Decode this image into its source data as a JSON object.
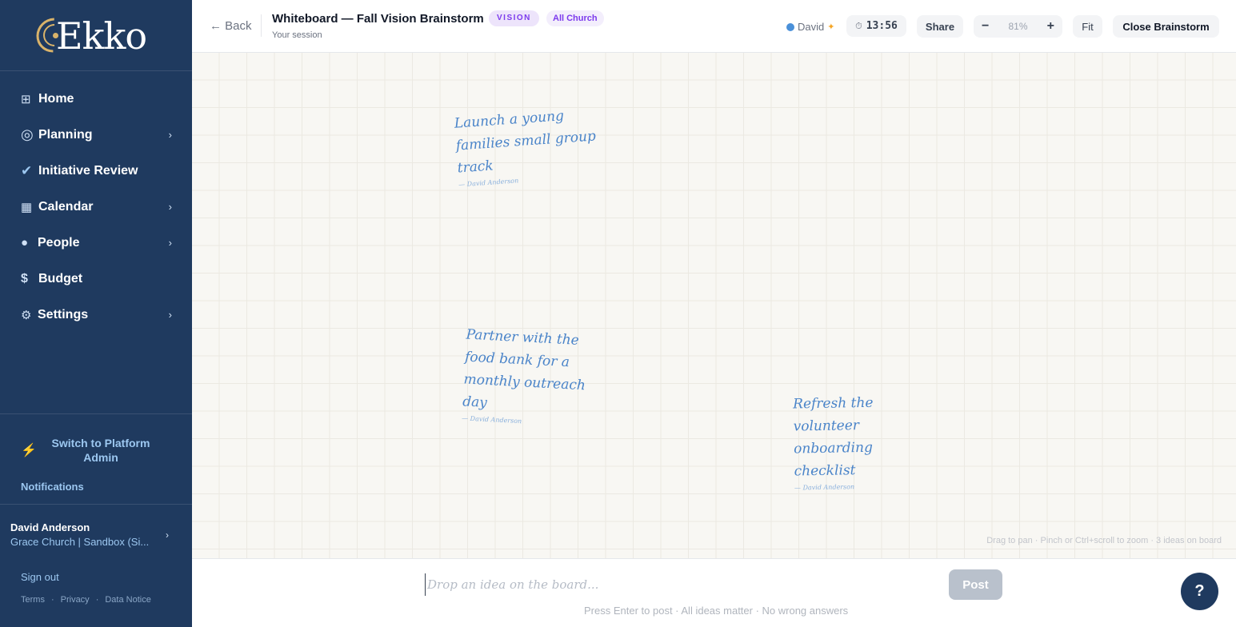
{
  "brand": {
    "logo_text": "Ekko",
    "gold": "#d9b36a",
    "navy": "#1f3a5f"
  },
  "sidebar": {
    "items": [
      {
        "label": "Home",
        "icon": "grid-icon",
        "has_submenu": false
      },
      {
        "label": "Planning",
        "icon": "target-icon",
        "has_submenu": true
      },
      {
        "label": "Initiative Review",
        "icon": "check-icon",
        "has_submenu": false
      },
      {
        "label": "Calendar",
        "icon": "calendar-icon",
        "has_submenu": true
      },
      {
        "label": "People",
        "icon": "person-dot-icon",
        "has_submenu": true
      },
      {
        "label": "Budget",
        "icon": "dollar-icon",
        "has_submenu": false
      },
      {
        "label": "Settings",
        "icon": "gear-icon",
        "has_submenu": true
      }
    ],
    "switch_admin": "Switch to Platform Admin",
    "notifications": "Notifications",
    "user": {
      "name": "David Anderson",
      "org": "Grace Church | Sandbox (Si..."
    },
    "sign_out": "Sign out",
    "legal": [
      "Terms",
      "·",
      "Privacy",
      "·",
      "Data Notice"
    ]
  },
  "header": {
    "back": "Back",
    "title": "Whiteboard — Fall Vision Brainstorm",
    "badge_type": "VISION",
    "badge_scope": "All Church",
    "session": "Your session",
    "presence_name": "David",
    "timer": "13:56",
    "share": "Share",
    "zoom": "81%",
    "fit": "Fit",
    "close": "Close Brainstorm"
  },
  "board": {
    "ideas": [
      {
        "text": "Launch a young families small group track",
        "author": "— David Anderson"
      },
      {
        "text": "Partner with the food bank for a monthly outreach day",
        "author": "— David Anderson"
      },
      {
        "text": "Refresh the volunteer onboarding checklist",
        "author": "— David Anderson"
      }
    ],
    "hint": "Drag to pan · Pinch or Ctrl+scroll to zoom · 3 ideas on board"
  },
  "composer": {
    "placeholder": "Drop an idea on the board...",
    "post": "Post",
    "hint": "Press Enter to post · All ideas matter · No wrong answers"
  },
  "help": "?"
}
